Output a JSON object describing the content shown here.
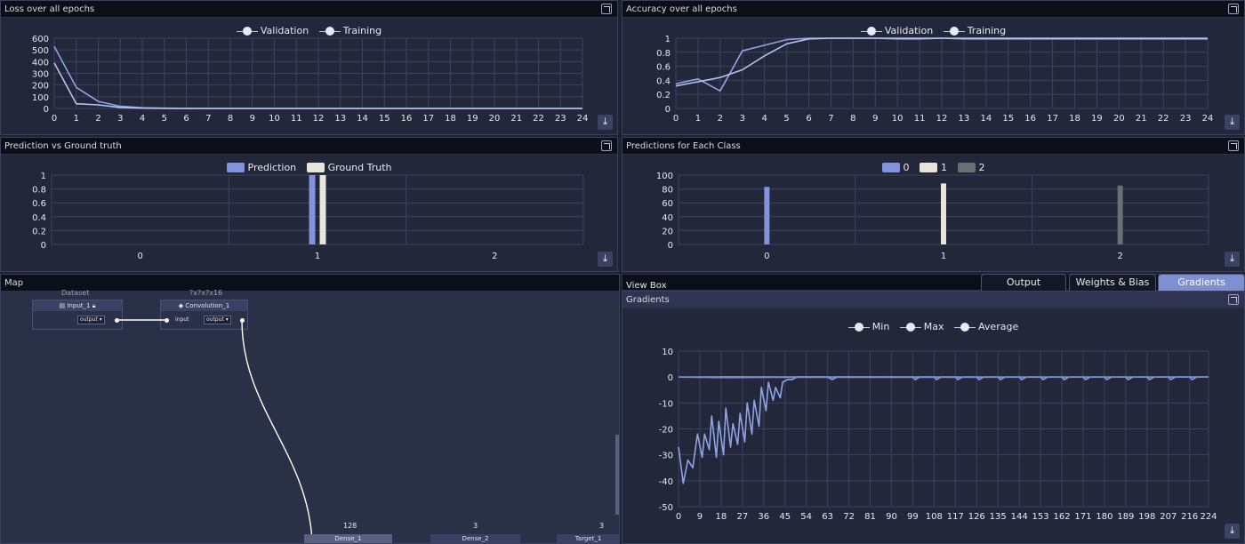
{
  "panels": {
    "loss": {
      "title": "Loss over all epochs"
    },
    "accuracy": {
      "title": "Accuracy over all epochs"
    },
    "pred_gt": {
      "title": "Prediction vs Ground truth"
    },
    "pred_class": {
      "title": "Predictions for Each Class"
    },
    "map": {
      "title": "Map"
    },
    "viewbox": {
      "title": "View Box"
    },
    "gradients": {
      "title": "Gradients"
    }
  },
  "tabs": [
    {
      "label": "Output",
      "active": false
    },
    {
      "label": "Weights & Bias",
      "active": false
    },
    {
      "label": "Gradients",
      "active": true
    }
  ],
  "map": {
    "top_labels": [
      "Dataset",
      "?x?x?x16"
    ],
    "nodes": {
      "input": {
        "title": "Input_1",
        "output": "output"
      },
      "conv": {
        "title": "Convolution_1",
        "input": "input",
        "output": "output"
      },
      "dense1": {
        "title": "Dense_1",
        "count": "128"
      },
      "dense2": {
        "title": "Dense_2",
        "count": "3"
      },
      "target": {
        "title": "Target_1",
        "count": "3"
      }
    }
  },
  "chart_data": [
    {
      "id": "loss",
      "type": "line",
      "title": "Loss over all epochs",
      "x": [
        0,
        1,
        2,
        3,
        4,
        5,
        6,
        7,
        8,
        9,
        10,
        11,
        12,
        13,
        14,
        15,
        16,
        17,
        18,
        19,
        20,
        21,
        22,
        23,
        24
      ],
      "xlim": [
        0,
        24
      ],
      "ylim": [
        0,
        600
      ],
      "yticks": [
        0,
        100,
        200,
        300,
        400,
        500,
        600
      ],
      "grid": true,
      "legend": "top-center",
      "series": [
        {
          "name": "Validation",
          "color": "#8fa3e6",
          "values": [
            530,
            180,
            60,
            18,
            6,
            2,
            1,
            0,
            0,
            0,
            0,
            0,
            0,
            0,
            0,
            0,
            0,
            0,
            0,
            0,
            0,
            0,
            0,
            0,
            0
          ]
        },
        {
          "name": "Training",
          "color": "#b7c3ef",
          "values": [
            390,
            40,
            30,
            8,
            2,
            1,
            0,
            0,
            0,
            0,
            0,
            0,
            0,
            0,
            0,
            0,
            0,
            0,
            0,
            0,
            0,
            0,
            0,
            0,
            0
          ]
        }
      ]
    },
    {
      "id": "accuracy",
      "type": "line",
      "title": "Accuracy over all epochs",
      "x": [
        0,
        1,
        2,
        3,
        4,
        5,
        6,
        7,
        8,
        9,
        10,
        11,
        12,
        13,
        14,
        15,
        16,
        17,
        18,
        19,
        20,
        21,
        22,
        23,
        24
      ],
      "xlim": [
        0,
        24
      ],
      "ylim": [
        0,
        1
      ],
      "yticks": [
        0,
        0.2,
        0.4,
        0.6,
        0.8,
        1
      ],
      "grid": true,
      "legend": "top-center",
      "series": [
        {
          "name": "Validation",
          "color": "#8fa3e6",
          "values": [
            0.35,
            0.42,
            0.25,
            0.82,
            0.9,
            0.98,
            1,
            1,
            1,
            1,
            0.99,
            0.99,
            1,
            0.99,
            0.99,
            0.99,
            0.99,
            0.99,
            0.99,
            0.99,
            0.99,
            0.99,
            0.99,
            0.99,
            0.99
          ]
        },
        {
          "name": "Training",
          "color": "#b7c3ef",
          "values": [
            0.32,
            0.38,
            0.44,
            0.55,
            0.75,
            0.92,
            0.99,
            1,
            1,
            1,
            1,
            1,
            1,
            1,
            1,
            1,
            1,
            1,
            1,
            1,
            1,
            1,
            1,
            1,
            1
          ]
        }
      ]
    },
    {
      "id": "pred_gt",
      "type": "bar",
      "title": "Prediction vs Ground truth",
      "categories": [
        "0",
        "1",
        "2"
      ],
      "ylim": [
        0,
        1
      ],
      "yticks": [
        0,
        0.2,
        0.4,
        0.6,
        0.8,
        1
      ],
      "legend": "top-center",
      "series": [
        {
          "name": "Prediction",
          "color": "#8292dc",
          "values": [
            0,
            1,
            0
          ]
        },
        {
          "name": "Ground Truth",
          "color": "#e8e6da",
          "values": [
            0,
            1,
            0
          ]
        }
      ]
    },
    {
      "id": "pred_class",
      "type": "bar",
      "title": "Predictions for Each Class",
      "categories": [
        "0",
        "1",
        "2"
      ],
      "ylim": [
        0,
        100
      ],
      "yticks": [
        0,
        20,
        40,
        60,
        80,
        100
      ],
      "legend": "top-center",
      "series": [
        {
          "name": "0",
          "color": "#8292dc",
          "values": [
            83,
            0,
            0
          ]
        },
        {
          "name": "1",
          "color": "#e8e6da",
          "values": [
            0,
            88,
            0
          ]
        },
        {
          "name": "2",
          "color": "#6b7075",
          "values": [
            0,
            0,
            85
          ]
        }
      ]
    },
    {
      "id": "gradients",
      "type": "line",
      "title": "Gradients",
      "xlim": [
        0,
        224
      ],
      "xticks": [
        0,
        9,
        18,
        27,
        36,
        45,
        54,
        63,
        72,
        81,
        90,
        99,
        108,
        117,
        126,
        135,
        144,
        153,
        162,
        171,
        180,
        189,
        198,
        207,
        216,
        224
      ],
      "ylim": [
        -50,
        10
      ],
      "yticks": [
        -50,
        -40,
        -30,
        -20,
        -10,
        0,
        10
      ],
      "grid": true,
      "legend": "top-center",
      "series": [
        {
          "name": "Min",
          "color": "#8fa3e6",
          "points": [
            [
              0,
              -27
            ],
            [
              2,
              -41
            ],
            [
              4,
              -32
            ],
            [
              6,
              -35
            ],
            [
              8,
              -22
            ],
            [
              10,
              -31
            ],
            [
              11,
              -22
            ],
            [
              13,
              -28
            ],
            [
              14,
              -15
            ],
            [
              16,
              -31
            ],
            [
              17,
              -17
            ],
            [
              19,
              -30
            ],
            [
              20,
              -12
            ],
            [
              22,
              -27
            ],
            [
              23,
              -18
            ],
            [
              25,
              -26
            ],
            [
              26,
              -14
            ],
            [
              28,
              -25
            ],
            [
              29,
              -10
            ],
            [
              31,
              -22
            ],
            [
              32,
              -9
            ],
            [
              34,
              -19
            ],
            [
              35,
              -4
            ],
            [
              37,
              -13
            ],
            [
              38,
              -2
            ],
            [
              40,
              -9
            ],
            [
              41,
              -4
            ],
            [
              43,
              -8
            ],
            [
              44,
              -2
            ],
            [
              46,
              -1
            ],
            [
              48,
              -1
            ],
            [
              50,
              0
            ],
            [
              63,
              0
            ],
            [
              65,
              -1
            ],
            [
              67,
              0
            ],
            [
              99,
              0
            ],
            [
              100,
              -1
            ],
            [
              102,
              0
            ],
            [
              108,
              0
            ],
            [
              109,
              -1
            ],
            [
              111,
              0
            ],
            [
              117,
              0
            ],
            [
              118,
              -1
            ],
            [
              120,
              0
            ],
            [
              126,
              0
            ],
            [
              127,
              -1
            ],
            [
              129,
              0
            ],
            [
              135,
              0
            ],
            [
              136,
              -1
            ],
            [
              138,
              0
            ],
            [
              144,
              0
            ],
            [
              145,
              -1
            ],
            [
              147,
              0
            ],
            [
              153,
              0
            ],
            [
              154,
              -1
            ],
            [
              156,
              0
            ],
            [
              162,
              0
            ],
            [
              163,
              -1
            ],
            [
              165,
              0
            ],
            [
              171,
              0
            ],
            [
              172,
              -1
            ],
            [
              174,
              0
            ],
            [
              180,
              0
            ],
            [
              181,
              -1
            ],
            [
              183,
              0
            ],
            [
              189,
              0
            ],
            [
              190,
              -1
            ],
            [
              192,
              0
            ],
            [
              198,
              0
            ],
            [
              199,
              -1
            ],
            [
              201,
              0
            ],
            [
              207,
              0
            ],
            [
              208,
              -1
            ],
            [
              210,
              0
            ],
            [
              216,
              0
            ],
            [
              217,
              -1
            ],
            [
              219,
              0
            ],
            [
              224,
              0
            ]
          ]
        },
        {
          "name": "Max",
          "color": "#b7c3ef",
          "points": [
            [
              0,
              0
            ],
            [
              224,
              0
            ]
          ]
        },
        {
          "name": "Average",
          "color": "#7d8fd6",
          "points": [
            [
              0,
              0
            ],
            [
              20,
              -0.2
            ],
            [
              40,
              -0.1
            ],
            [
              224,
              0
            ]
          ]
        }
      ]
    }
  ]
}
